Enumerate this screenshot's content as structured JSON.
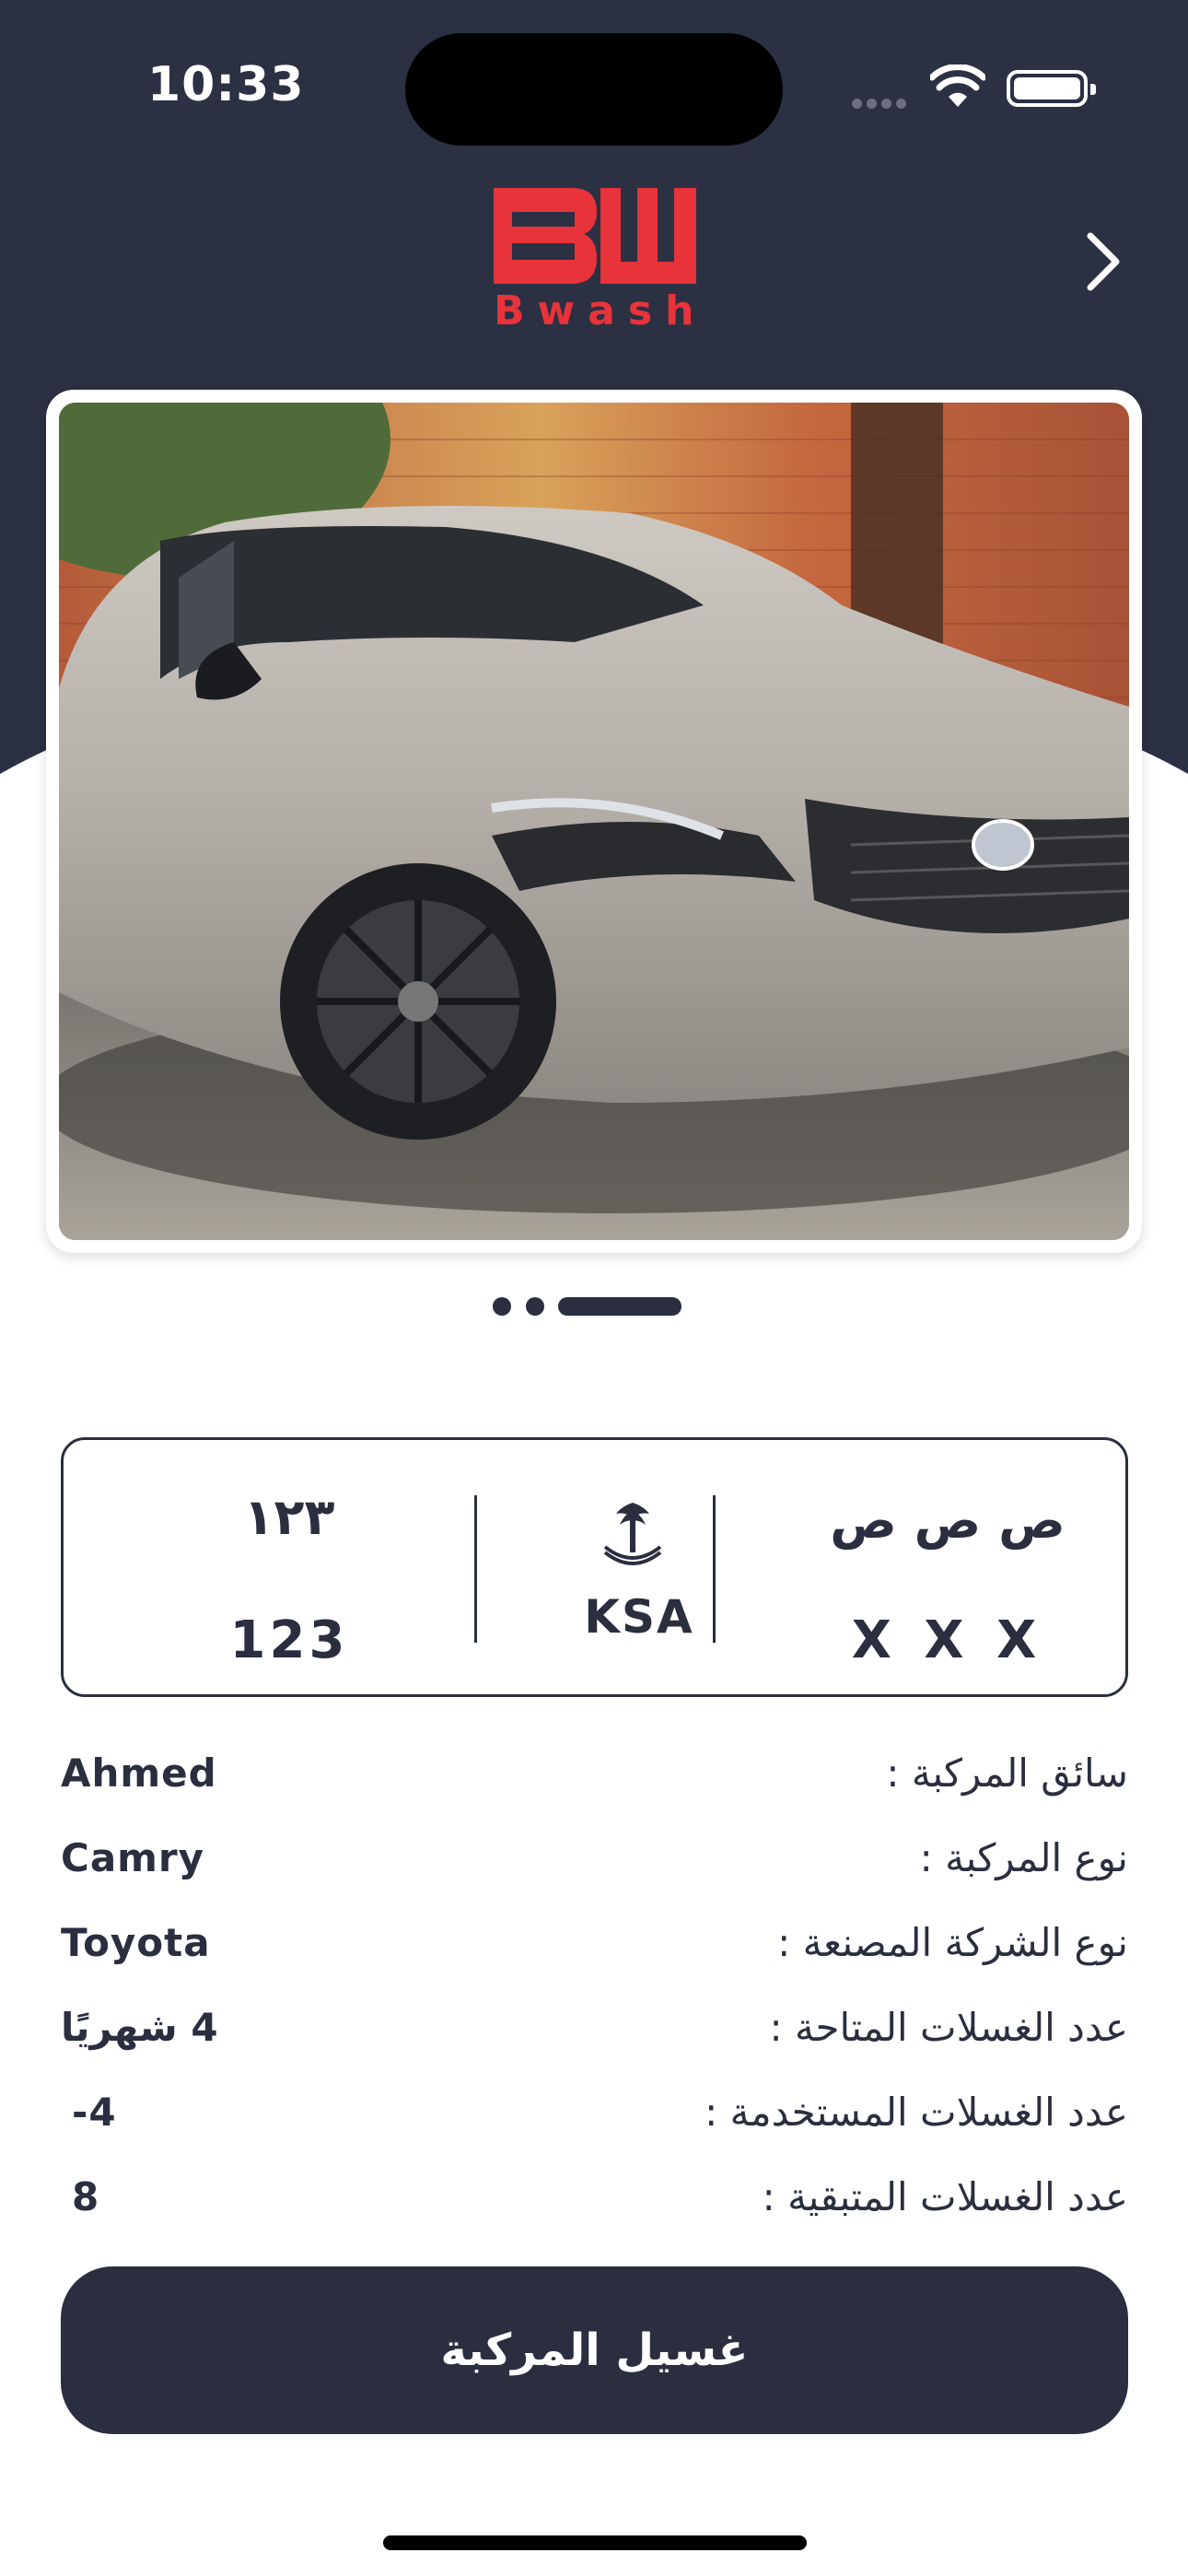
{
  "status_bar": {
    "time": "10:33"
  },
  "header": {
    "logo_text": "Bwash",
    "brand_color": "#e8333a",
    "background_color": "#2c3043",
    "back_icon": "chevron-right-icon"
  },
  "carousel": {
    "image_alt": "Toyota Camry",
    "page_count": 3,
    "active_page": 3
  },
  "plate": {
    "arabic_numbers": "١٢٣",
    "numbers": "123",
    "country": "KSA",
    "emblem_icon": "saudi-emblem-icon",
    "arabic_letters": "ص ص ص",
    "letters": "X X X"
  },
  "info": [
    {
      "label": "سائق المركبة :",
      "value": "Ahmed"
    },
    {
      "label": "نوع المركبة :",
      "value": "Camry"
    },
    {
      "label": "نوع الشركة المصنعة :",
      "value": "Toyota"
    },
    {
      "label": "عدد الغسلات المتاحة :",
      "value": "4  شهريًا"
    },
    {
      "label": "عدد الغسلات المستخدمة :",
      "value": "-4"
    },
    {
      "label": "عدد الغسلات المتبقية :",
      "value": "8"
    }
  ],
  "action": {
    "wash_label": "غسيل المركبة"
  }
}
